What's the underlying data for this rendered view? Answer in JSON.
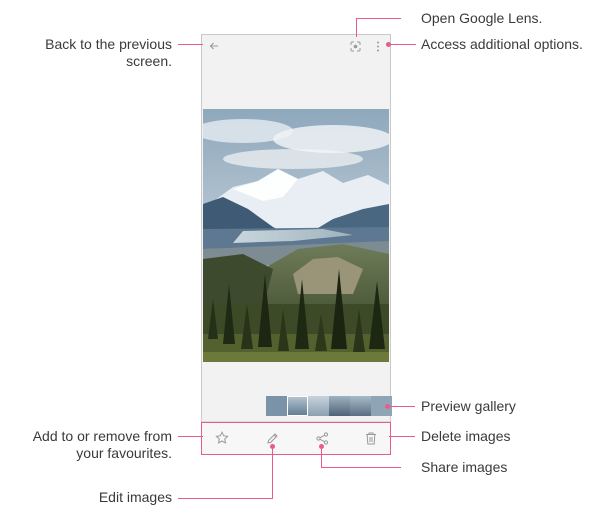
{
  "annotations": {
    "back": "Back to the previous screen.",
    "lens": "Open Google Lens.",
    "options": "Access additional options.",
    "preview": "Preview gallery",
    "favourites": "Add to or remove from your favourites.",
    "delete": "Delete images",
    "share": "Share images",
    "edit": "Edit images"
  },
  "icons": {
    "back": "back-arrow-icon",
    "lens": "google-lens-icon",
    "options": "more-vertical-icon",
    "favourite": "star-icon",
    "edit": "pencil-icon",
    "share": "share-icon",
    "delete": "trash-icon"
  },
  "colors": {
    "callout": "#e85c8a",
    "icon": "#9a9a9a"
  }
}
